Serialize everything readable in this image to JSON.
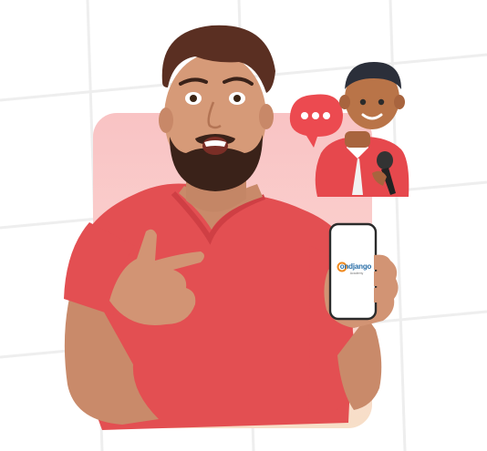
{
  "image": {
    "subject": "man-in-red-tshirt-pointing-at-phone",
    "accent_colors": {
      "card_pink": "#f9c3c4",
      "shirt_red": "#e34f52",
      "bubble_red": "#ec4a50",
      "brand_blue": "#2a6fa8",
      "brand_orange": "#f08a1f"
    }
  },
  "phone": {
    "logo_text": "ondjango",
    "logo_sub": "Academy"
  },
  "icons": {
    "chat_bubble": "chat-bubble-icon",
    "speaker_avatar": "avatar-with-microphone"
  }
}
